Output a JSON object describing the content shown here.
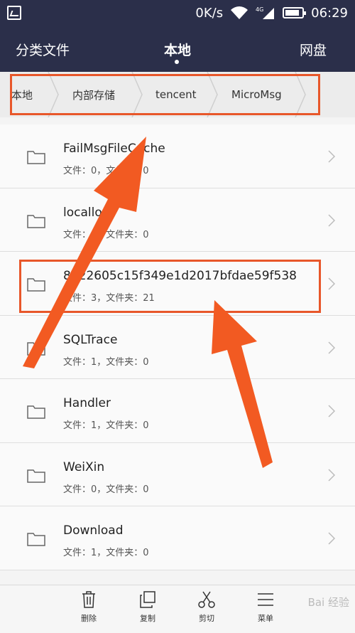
{
  "status_bar": {
    "network_speed": "0K/s",
    "signal_label": "4G",
    "time": "06:29",
    "battery_level": 0.85
  },
  "top_nav": {
    "tabs": [
      {
        "label": "分类文件"
      },
      {
        "label": "本地"
      },
      {
        "label": "网盘"
      }
    ]
  },
  "breadcrumb": {
    "items": [
      "本地",
      "内部存储",
      "tencent",
      "MicroMsg"
    ]
  },
  "files": [
    {
      "name": "FailMsgFileCache",
      "meta": "文件：0，文件夹：0"
    },
    {
      "name": "locallog",
      "meta": "文件：1，文件夹：0"
    },
    {
      "name": "8322605c15f349e1d2017bfdae59f538",
      "meta": "文件：3，文件夹：21"
    },
    {
      "name": "SQLTrace",
      "meta": "文件：1，文件夹：0"
    },
    {
      "name": "Handler",
      "meta": "文件：1，文件夹：0"
    },
    {
      "name": "WeiXin",
      "meta": "文件：0，文件夹：0"
    },
    {
      "name": "Download",
      "meta": "文件：1，文件夹：0"
    }
  ],
  "toolbar": {
    "delete_label": "删除",
    "copy_label": "复制",
    "cut_label": "剪切",
    "menu_label": "菜单"
  },
  "watermark": "Bai 经验",
  "colors": {
    "header_bg": "#2b2f4a",
    "annotation": "#e8572a"
  }
}
